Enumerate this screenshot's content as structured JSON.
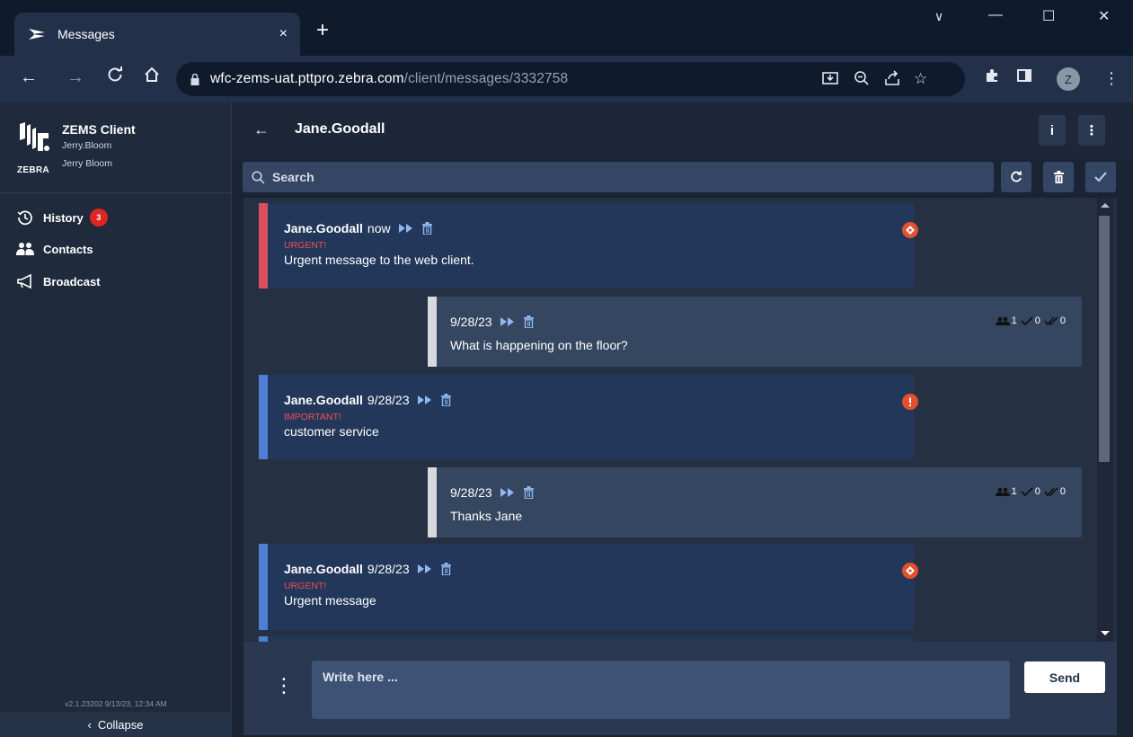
{
  "browser": {
    "tab_title": "Messages",
    "tab_close": "×",
    "new_tab": "+",
    "url_host": "wfc-zems-uat.pttpro.zebra.com",
    "url_path": "/client/messages/3332758",
    "profile_initial": "Z",
    "window_controls": {
      "minimize_menu": "∨",
      "minimize": "—",
      "maximize": "☐",
      "close": "✕"
    }
  },
  "sidebar": {
    "app_title": "ZEMS Client",
    "brand": "ZEBRA",
    "user_login": "Jerry.Bloom",
    "user_name": "Jerry Bloom",
    "nav": [
      {
        "label": "History",
        "badge": "3",
        "icon": "history-icon"
      },
      {
        "label": "Contacts",
        "icon": "contacts-icon"
      },
      {
        "label": "Broadcast",
        "icon": "megaphone-icon"
      }
    ],
    "version": "v2.1.23202 9/13/23, 12:34 AM",
    "collapse_label": "Collapse"
  },
  "chat": {
    "back": "←",
    "title": "Jane.Goodall",
    "info_label": "i",
    "more_label": "⋮",
    "search_placeholder": "Search",
    "messages": [
      {
        "direction": "in",
        "sender": "Jane.Goodall",
        "time": "now",
        "priority": "URGENT!",
        "body": "Urgent message to the web client.",
        "accent": "#d9505a",
        "alert": "urgent"
      },
      {
        "direction": "out",
        "time": "9/28/23",
        "body": "What is happening on the floor?",
        "receipts": {
          "recipients": "1",
          "delivered": "0",
          "read": "0"
        },
        "accent": "#d6d9de"
      },
      {
        "direction": "in",
        "sender": "Jane.Goodall",
        "time": "9/28/23",
        "priority": "IMPORTANT!",
        "body": "customer service",
        "accent": "#4d7fd4",
        "alert": "important"
      },
      {
        "direction": "out",
        "time": "9/28/23",
        "body": "Thanks Jane",
        "receipts": {
          "recipients": "1",
          "delivered": "0",
          "read": "0"
        },
        "accent": "#d6d9de"
      },
      {
        "direction": "in",
        "sender": "Jane.Goodall",
        "time": "9/28/23",
        "priority": "URGENT!",
        "body": "Urgent message",
        "accent": "#4d7fd4",
        "alert": "urgent"
      }
    ],
    "compose_placeholder": "Write here ...",
    "send_label": "Send"
  }
}
